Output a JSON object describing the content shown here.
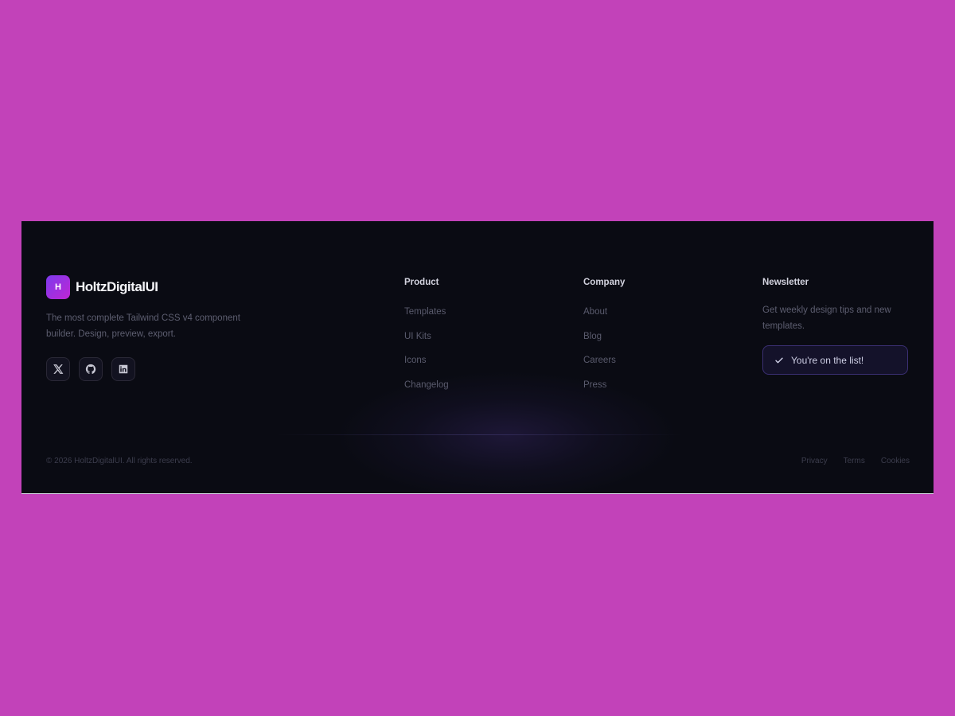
{
  "brand": {
    "logo_letter": "H",
    "name": "HoltzDigitalUI",
    "tagline": "The most complete Tailwind CSS v4 component builder. Design, preview, export."
  },
  "socials": [
    {
      "icon": "x-icon"
    },
    {
      "icon": "github-icon"
    },
    {
      "icon": "linkedin-icon"
    }
  ],
  "columns": {
    "product": {
      "title": "Product",
      "links": [
        "Templates",
        "UI Kits",
        "Icons",
        "Changelog"
      ]
    },
    "company": {
      "title": "Company",
      "links": [
        "About",
        "Blog",
        "Careers",
        "Press"
      ]
    }
  },
  "newsletter": {
    "title": "Newsletter",
    "description": "Get weekly design tips and new templates.",
    "success_message": "You're on the list!"
  },
  "bottom": {
    "copyright": "© 2026 HoltzDigitalUI. All rights reserved.",
    "legal": [
      "Privacy",
      "Terms",
      "Cookies"
    ]
  },
  "colors": {
    "page_background": "#c242b9",
    "footer_background": "#0a0b13",
    "accent_start": "#7c3aed",
    "accent_end": "#c026d3"
  }
}
